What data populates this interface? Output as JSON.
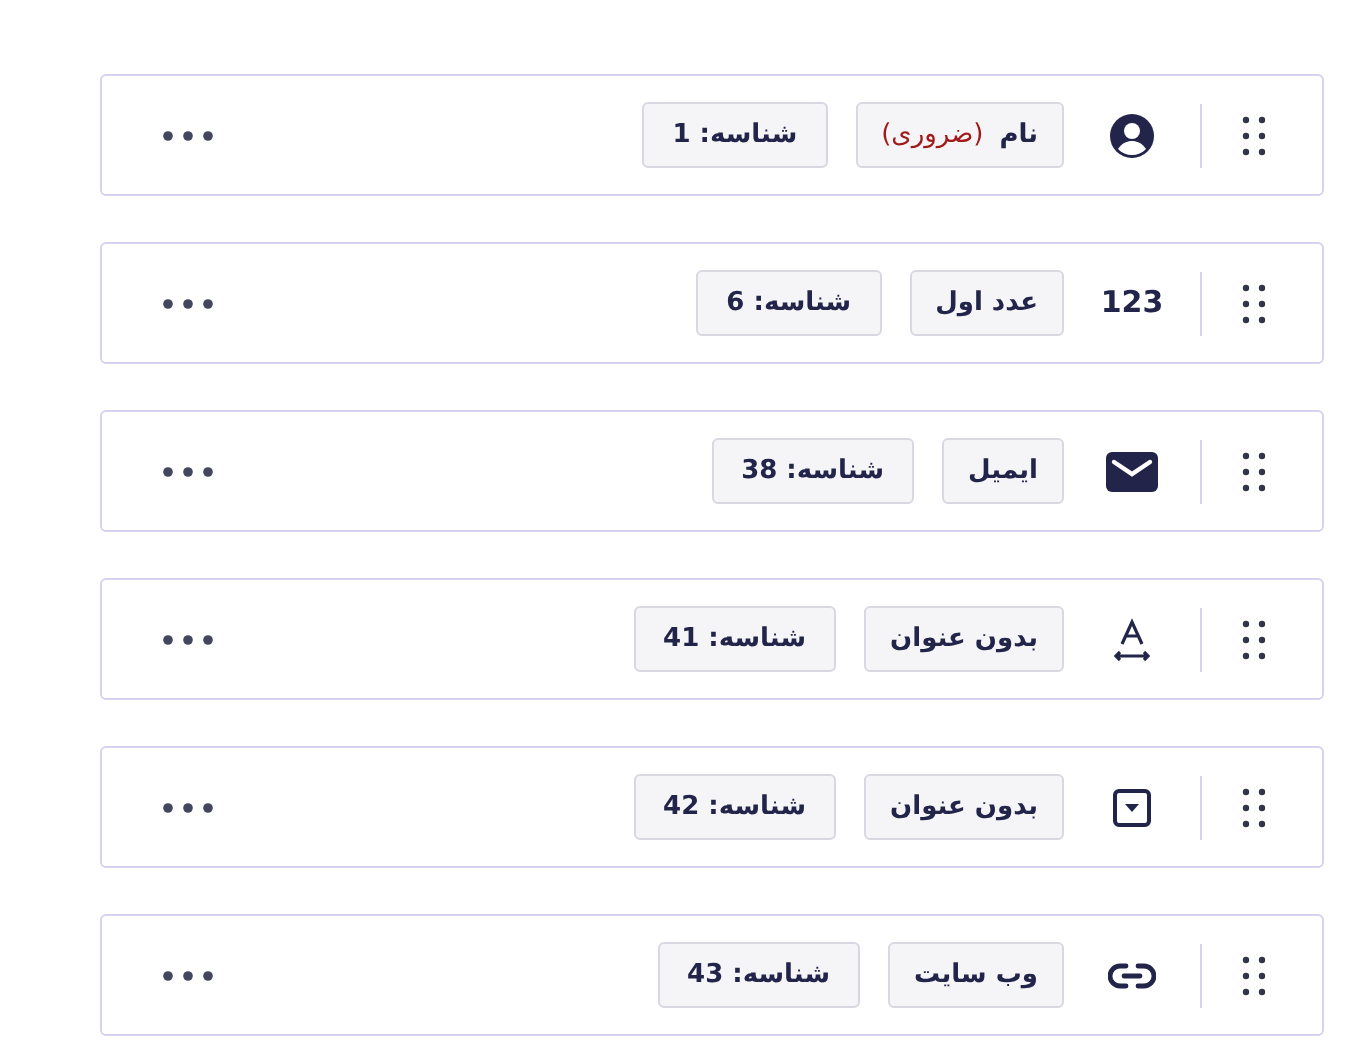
{
  "fields": [
    {
      "kind": "person",
      "label": "نام",
      "required_note": "(ضروری)",
      "id_text": "شناسه: 1"
    },
    {
      "kind": "number",
      "icon_text": "123",
      "label": "عدد اول",
      "id_text": "شناسه: 6"
    },
    {
      "kind": "email",
      "label": "ایمیل",
      "id_text": "شناسه: 38"
    },
    {
      "kind": "text",
      "label": "بدون عنوان",
      "id_text": "شناسه: 41"
    },
    {
      "kind": "dropdown",
      "label": "بدون عنوان",
      "id_text": "شناسه: 42"
    },
    {
      "kind": "link",
      "label": "وب سایت",
      "id_text": "شناسه: 43"
    }
  ]
}
